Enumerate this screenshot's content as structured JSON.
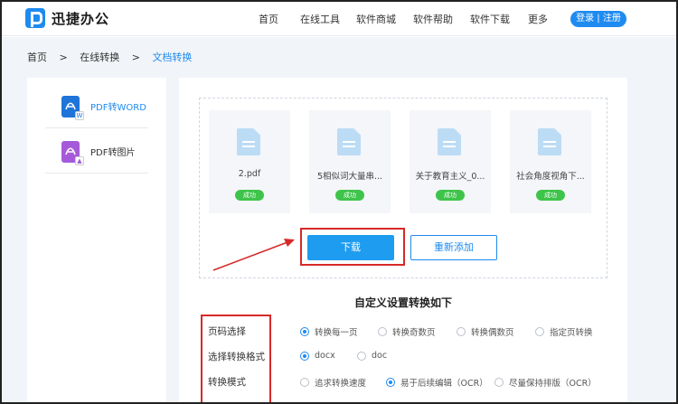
{
  "header": {
    "logo_text": "迅捷办公",
    "nav": [
      "首页",
      "在线工具",
      "软件商城",
      "软件帮助",
      "软件下载",
      "更多"
    ],
    "login_label": "登录 | 注册"
  },
  "breadcrumb": {
    "items": [
      "首页",
      ">",
      "在线转换",
      ">",
      "文档转换"
    ]
  },
  "sidebar": {
    "items": [
      {
        "label": "PDF转WORD",
        "icon": "pdf-to-word-icon",
        "active": true
      },
      {
        "label": "PDF转图片",
        "icon": "pdf-to-image-icon",
        "active": false
      }
    ]
  },
  "files": [
    {
      "name": "2.pdf",
      "status": "成功"
    },
    {
      "name": "5相似词大量串...",
      "status": "成功"
    },
    {
      "name": "关于教育主义_0...",
      "status": "成功"
    },
    {
      "name": "社会角度视角下...",
      "status": "成功"
    }
  ],
  "actions": {
    "download_label": "下载",
    "readd_label": "重新添加"
  },
  "settings": {
    "title": "自定义设置转换如下",
    "rows": [
      {
        "label": "页码选择",
        "options": [
          "转换每一页",
          "转换奇数页",
          "转换偶数页",
          "指定页转换"
        ],
        "selected": 0
      },
      {
        "label": "选择转换格式",
        "options": [
          "docx",
          "doc"
        ],
        "selected": 0
      },
      {
        "label": "转换模式",
        "options": [
          "追求转换速度",
          "易于后续编辑（OCR）",
          "尽量保持排版（OCR）"
        ],
        "selected": 1
      }
    ]
  },
  "colors": {
    "accent": "#1e8bf0",
    "success": "#3ec44a",
    "annotation": "#d62828"
  }
}
